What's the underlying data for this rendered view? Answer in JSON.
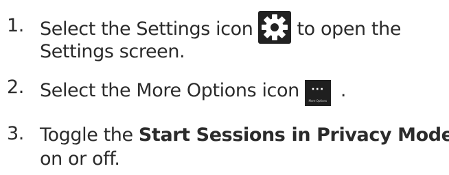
{
  "steps": [
    {
      "number": "1.",
      "line1_before": "Select the Settings icon",
      "line1_after": "to open the",
      "line2": "Settings screen.",
      "icon": "gear-icon"
    },
    {
      "number": "2.",
      "text_before": "Select the More Options icon",
      "text_after": ".",
      "icon": "more-options-icon",
      "icon_dots": "···",
      "icon_caption": "More Options"
    },
    {
      "number": "3.",
      "text_before": "Toggle the ",
      "bold": "Start Sessions in Privacy Mode",
      "line2": "on or off."
    }
  ]
}
